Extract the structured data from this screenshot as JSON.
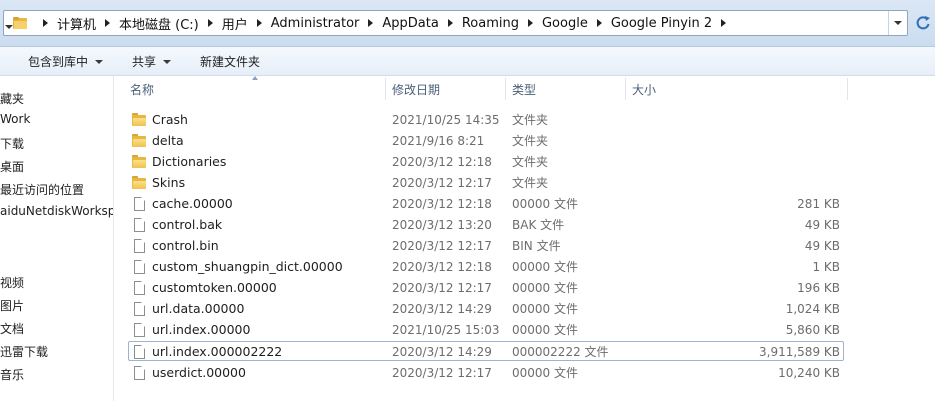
{
  "breadcrumbs": [
    "计算机",
    "本地磁盘 (C:)",
    "用户",
    "Administrator",
    "AppData",
    "Roaming",
    "Google",
    "Google Pinyin 2"
  ],
  "toolbar": {
    "include_label": "包含到库中",
    "share_label": "共享",
    "new_folder_label": "新建文件夹"
  },
  "nav": {
    "items": [
      "藏夹",
      "Work",
      "下载",
      "桌面",
      "最近访问的位置",
      "aiduNetdiskWorksp",
      "视频",
      "图片",
      "文档",
      "迅雷下载",
      "音乐"
    ]
  },
  "columns": {
    "name": "名称",
    "date": "修改日期",
    "type": "类型",
    "size": "大小"
  },
  "files": [
    {
      "icon": "folder-icon",
      "name": "Crash",
      "date": "2021/10/25 14:35",
      "type": "文件夹",
      "size": ""
    },
    {
      "icon": "folder-icon",
      "name": "delta",
      "date": "2021/9/16 8:21",
      "type": "文件夹",
      "size": ""
    },
    {
      "icon": "folder-icon",
      "name": "Dictionaries",
      "date": "2020/3/12 12:18",
      "type": "文件夹",
      "size": ""
    },
    {
      "icon": "folder-icon",
      "name": "Skins",
      "date": "2020/3/12 12:17",
      "type": "文件夹",
      "size": ""
    },
    {
      "icon": "file-icon",
      "name": "cache.00000",
      "date": "2020/3/12 12:18",
      "type": "00000 文件",
      "size": "281 KB"
    },
    {
      "icon": "file-icon",
      "name": "control.bak",
      "date": "2020/3/12 13:20",
      "type": "BAK 文件",
      "size": "49 KB"
    },
    {
      "icon": "file-icon",
      "name": "control.bin",
      "date": "2020/3/12 12:17",
      "type": "BIN 文件",
      "size": "49 KB"
    },
    {
      "icon": "file-icon",
      "name": "custom_shuangpin_dict.00000",
      "date": "2020/3/12 12:18",
      "type": "00000 文件",
      "size": "1 KB"
    },
    {
      "icon": "file-icon",
      "name": "customtoken.00000",
      "date": "2020/3/12 12:17",
      "type": "00000 文件",
      "size": "196 KB"
    },
    {
      "icon": "file-icon",
      "name": "url.data.00000",
      "date": "2020/3/12 14:29",
      "type": "00000 文件",
      "size": "1,024 KB"
    },
    {
      "icon": "file-icon",
      "name": "url.index.00000",
      "date": "2021/10/25 15:03",
      "type": "00000 文件",
      "size": "5,860 KB"
    },
    {
      "icon": "file-icon",
      "name": "url.index.000002222",
      "date": "2020/3/12 14:29",
      "type": "000002222 文件",
      "size": "3,911,589 KB",
      "selected": true
    },
    {
      "icon": "file-icon",
      "name": "userdict.00000",
      "date": "2020/3/12 12:17",
      "type": "00000 文件",
      "size": "10,240 KB"
    }
  ],
  "colors": {
    "folder": "#e7b841",
    "selection_border": "#9db3d0",
    "header_text": "#4c607a",
    "meta_text": "#6d6d6d"
  }
}
